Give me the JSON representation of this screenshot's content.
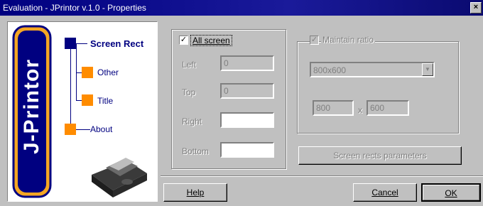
{
  "window": {
    "title": "Evaluation - JPrintor v.1.0 - Properties",
    "close_glyph": "×"
  },
  "logo": {
    "text": "J-Printor",
    "letters": [
      "J",
      "P",
      "r",
      "i",
      "n",
      "t",
      "o",
      "r"
    ]
  },
  "nav": {
    "items": [
      {
        "label": "Screen Rect",
        "active": true
      },
      {
        "label": "Other",
        "active": false
      },
      {
        "label": "Title",
        "active": false
      },
      {
        "label": "About",
        "active": false
      }
    ]
  },
  "screen_rect": {
    "all_screen_label": "All screen",
    "all_screen_checked": true,
    "left_label": "Left",
    "left_value": "0",
    "top_label": "Top",
    "top_value": "0",
    "right_label": "Right",
    "right_value": "",
    "bottom_label": "Bottom",
    "bottom_value": ""
  },
  "ratio": {
    "maintain_label": "Maintain ratio",
    "maintain_checked": true,
    "resolution_selected": "800x600",
    "width_value": "800",
    "times_glyph": "x",
    "height_value": "600",
    "params_button": "Screen rects parameters"
  },
  "buttons": {
    "help": "Help",
    "cancel": "Cancel",
    "ok": "OK"
  },
  "colors": {
    "title_bar": "#000080",
    "node": "#ff8c00",
    "active_node": "#000080",
    "logo_orange": "#f5a623"
  }
}
